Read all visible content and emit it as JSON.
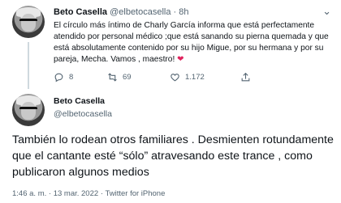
{
  "tweet1": {
    "name": "Beto Casella",
    "handle": "@elbetocasella",
    "separator": "·",
    "time": "8h",
    "text": "El círculo más íntimo de Charly García informa que está perfectamente atendido por personal médico ;que está sanando su pierna quemada y que está absolutamente contenido por su hijo Migue, por su hermana y por su pareja, Mecha. Vamos , maestro!",
    "heart": "❤",
    "counts": {
      "replies": "8",
      "retweets": "69",
      "likes": "1.172"
    },
    "icons": [
      "reply-icon",
      "retweet-icon",
      "like-icon",
      "share-icon",
      "more-icon"
    ]
  },
  "tweet2": {
    "name": "Beto Casella",
    "handle": "@elbetocasella",
    "text": "También lo rodean otros familiares . Desmienten rotundamente que el cantante esté “sólo” atravesando este trance , como publicaron algunos medios",
    "time": "1:46 a. m.",
    "dot": "·",
    "date": "13 mar. 2022",
    "source": "Twitter for iPhone"
  }
}
